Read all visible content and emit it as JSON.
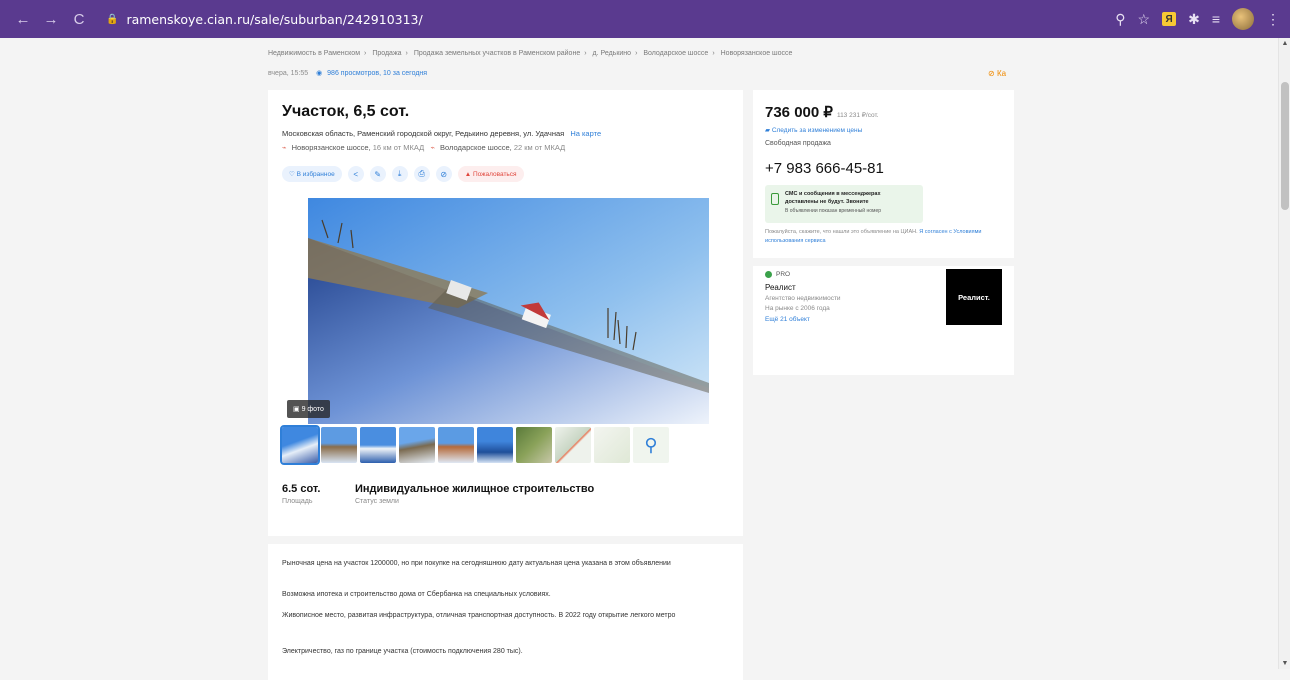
{
  "browser": {
    "url": "ramenskoye.cian.ru/sale/suburban/242910313/"
  },
  "breadcrumbs": [
    "Недвижимость в Раменском",
    "Продажа",
    "Продажа земельных участков в Раменском районе",
    "д. Редькино",
    "Володарское шоссе",
    "Новорязанское шоссе"
  ],
  "meta": {
    "updated": "вчера, 15:55",
    "views": "986 просмотров, 10 за сегодня",
    "report": "Ка"
  },
  "listing": {
    "title": "Участок, 6,5 сот.",
    "address": "Московская область, Раменский городской округ, Редькино деревня, ул. Удачная",
    "map_link": "На карте",
    "roads": [
      {
        "name": "Новорязанское шоссе,",
        "dist": "16 км от МКАД"
      },
      {
        "name": "Володарское шоссе,",
        "dist": "22 км от МКАД"
      }
    ],
    "actions": {
      "favorite": "В избранное",
      "complain": "Пожаловаться"
    },
    "photo_count": "9 фото",
    "stats": [
      {
        "value": "6.5 сот.",
        "label": "Площадь"
      },
      {
        "value": "Индивидуальное жилищное строительство",
        "label": "Статус земли"
      }
    ],
    "description": [
      "Рыночная цена на участок 1200000, но при покупке на сегодняшнюю дату актуальная цена указана в этом объявлении",
      "Возможна ипотека и строительство дома от Сбербанка на специальных условиях.",
      "Живописное место, развитая инфраструктура, отличная транспортная доступность. В 2022 году открытие легкого метро",
      "Электричество, газ по границе участка (стоимость подключения 280 тыс)."
    ]
  },
  "sidebar": {
    "price": "736 000 ₽",
    "price_per_sotka": "113 231 ₽/сот.",
    "follow_price": "Следить за изменением цены",
    "sale_type": "Свободная продажа",
    "phone": "+7 983 666-45-81",
    "sms": {
      "line1": "СМС и сообщения в мессенджерах",
      "line2": "доставлены не будут. Звоните",
      "line3": "В объявлении показан временный номер"
    },
    "tell": "Пожалуйста, скажите, что нашли это объявление на ЦИАН.",
    "tell_link": "Я согласен с Условиями",
    "tell_link2": "использования сервиса",
    "agent": {
      "badge": "PRO",
      "name": "Реалист",
      "type": "Агентство недвижимости",
      "since": "На рынке с 2006 года",
      "more": "Ещё 21 объект",
      "logo_text": "Реалист."
    }
  },
  "colors": {
    "chrome": "#5a3a8f",
    "link": "#2f7fd8",
    "accent_orange": "#f08a00"
  }
}
